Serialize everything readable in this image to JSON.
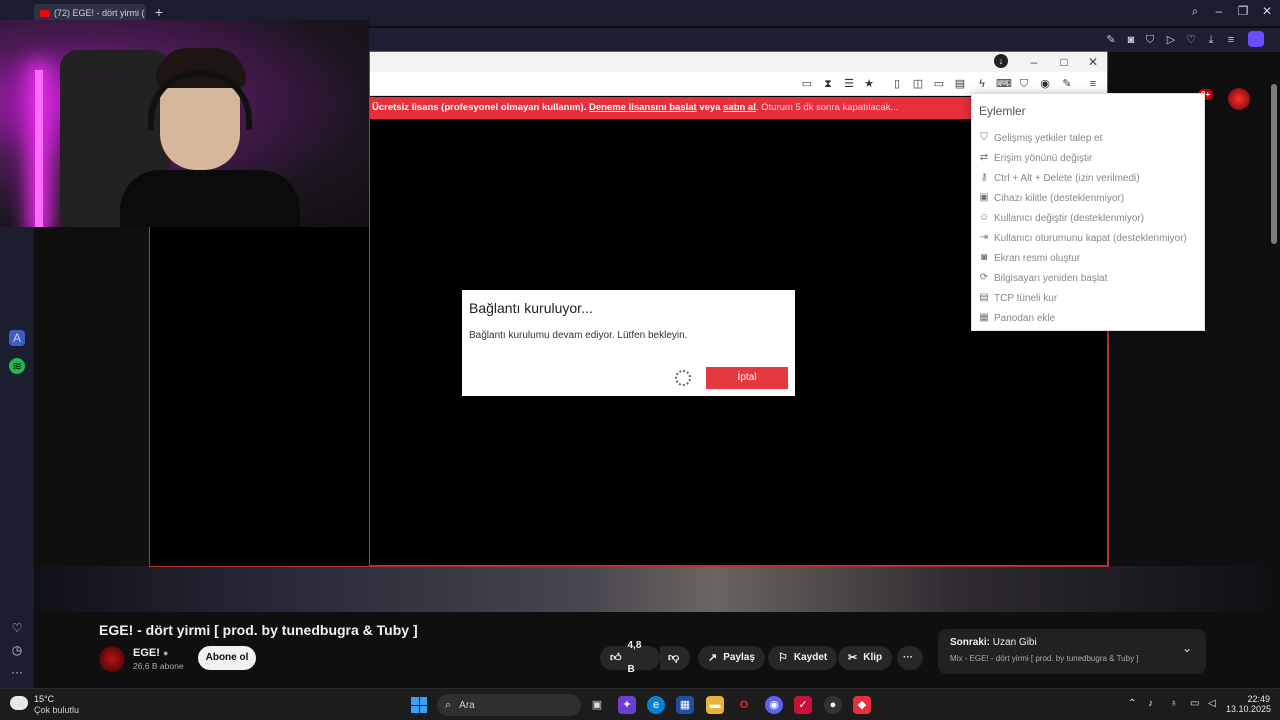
{
  "browser": {
    "tab_title": "(72) EGE! - dört yirmi (",
    "new_tab": "+"
  },
  "remote": {
    "license_banner": {
      "part1": "Ücretsiz lisans (profesyonel olmayan kullanım).",
      "trial_link": "Deneme lisansını başlat",
      "or_text": "veya",
      "buy_link": "satın al",
      "tail": ". Oturum 5 dk sonra kapatılacak..."
    },
    "dialog": {
      "title": "Bağlantı kuruluyor...",
      "message": "Bağlantı kurulumu devam ediyor. Lütfen bekleyin.",
      "cancel_label": "İptal"
    },
    "actions_menu": {
      "title": "Eylemler",
      "items": [
        {
          "label": "Gelişmiş yetkiler talep et",
          "icon": "shield-icon"
        },
        {
          "label": "Erişim yönünü değiştir",
          "icon": "swap-icon"
        },
        {
          "label": "Ctrl + Alt + Delete (izin verilmedi)",
          "icon": "keys-icon"
        },
        {
          "label": "Cihazı kilitle (desteklenmiyor)",
          "icon": "lock-icon"
        },
        {
          "label": "Kullanıcı değiştir (desteklenmiyor)",
          "icon": "user-switch-icon"
        },
        {
          "label": "Kullanıcı oturumunu kapat (desteklenmiyor)",
          "icon": "logout-icon"
        },
        {
          "label": "Ekran resmi oluştur",
          "icon": "camera-icon"
        },
        {
          "label": "Bilgisayarı yeniden başlat",
          "icon": "restart-icon"
        },
        {
          "label": "TCP tüneli kur",
          "icon": "tunnel-icon"
        },
        {
          "label": "Panodan ekle",
          "icon": "clipboard-icon"
        }
      ]
    }
  },
  "youtube": {
    "video_title": "EGE! - dört yirmi [ prod. by tunedbugra & Tuby ]",
    "channel_name": "EGE!",
    "subscribers": "26,6 B abone",
    "subscribe_label": "Abone ol",
    "likes": "4,8 B",
    "share_label": "Paylaş",
    "save_label": "Kaydet",
    "clip_label": "Klip",
    "more_label": "···",
    "notif_badge": "9+",
    "next": {
      "label": "Sonraki:",
      "title": "Uzan Gibi",
      "subtitle": "Mix - EGE! - dört yirmi [ prod. by tunedbugra & Tuby ]"
    }
  },
  "taskbar": {
    "temperature": "15°C",
    "condition": "Çok bulutlu",
    "search_placeholder": "Ara",
    "time": "22:49",
    "date": "13.10.2025"
  },
  "colors": {
    "accent_red": "#e8303d",
    "cancel_red": "#e43a3f",
    "yt_bg": "#0f0f0f"
  }
}
